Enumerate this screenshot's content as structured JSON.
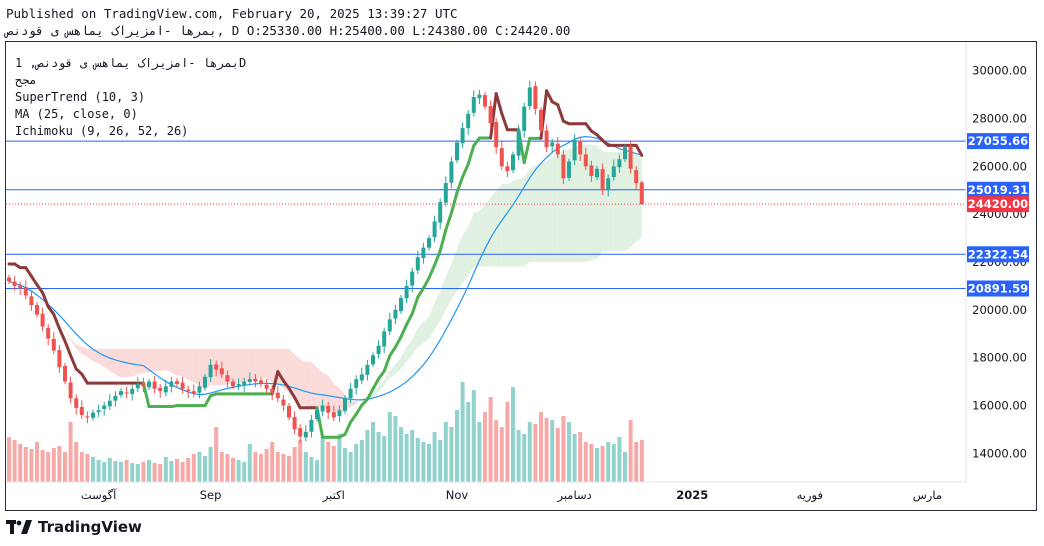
{
  "header": {
    "line1": "Published on TradingView.com, February 20, 2025 13:39:27 UTC",
    "line2": "بمرها -امزیراک یماهس ی قودنص, D O:25330.00 H:25400.00 L:24380.00 C:24420.00"
  },
  "legend": {
    "symbol": "بمرها -امزیراک یماهس ی قودنص, 1D",
    "line2": "مجح",
    "supertrend": "SuperTrend (10, 3)",
    "ma": "MA (25, close, 0)",
    "ichimoku": "Ichimoku (9, 26, 52, 26)"
  },
  "brand": {
    "name": "TradingView",
    "logo_icon": "tradingview-logo-icon"
  },
  "colors": {
    "up": "#26a69a",
    "down": "#ef5350",
    "supertrend_up": "#4caf50",
    "supertrend_down": "#8d3a3a",
    "ma": "#2196f3",
    "level": "#2962ff",
    "cloud_bull": "#c8e6c9",
    "cloud_bear": "#f8bbbb",
    "current_price": "#f23645"
  },
  "chart_data": {
    "type": "candlestick",
    "yticks": [
      14000,
      16000,
      18000,
      20000,
      22000,
      24000,
      26000,
      28000,
      30000
    ],
    "ylim": [
      12800,
      31200
    ],
    "xtick_labels": [
      "آگوست",
      "Sep",
      "اکتبر",
      "Nov",
      "دسامبر",
      "2025",
      "فوریه",
      "مارس"
    ],
    "levels": [
      27055.66,
      25019.31,
      22322.54,
      20891.59
    ],
    "level_labels": [
      "27055.66",
      "25019.31",
      "22322.54",
      "20891.59"
    ],
    "current_price": 24420.0,
    "current_price_label": "24420.00",
    "ohlc": {
      "open": 25330.0,
      "high": 25400.0,
      "low": 24380.0,
      "close": 24420.0
    },
    "closes": [
      21200,
      21000,
      20900,
      20600,
      20200,
      19800,
      19300,
      18800,
      18300,
      17600,
      17000,
      16300,
      15900,
      15600,
      15500,
      15700,
      15800,
      16000,
      16200,
      16400,
      16600,
      16500,
      16700,
      16900,
      16800,
      17000,
      16700,
      16600,
      16800,
      17000,
      16900,
      16700,
      16600,
      16500,
      16800,
      17200,
      17700,
      17500,
      17300,
      17000,
      16800,
      16900,
      17000,
      17100,
      17000,
      16900,
      16700,
      16500,
      16300,
      16000,
      15500,
      15000,
      14700,
      14900,
      15400,
      15800,
      16000,
      15700,
      15500,
      15800,
      16300,
      16700,
      17100,
      17300,
      17700,
      18100,
      18500,
      19100,
      19600,
      20000,
      20500,
      21000,
      21600,
      22200,
      22600,
      23000,
      23700,
      24500,
      25300,
      26200,
      27000,
      27600,
      28200,
      28900,
      29000,
      28500,
      27800,
      26800,
      26000,
      25800,
      26500,
      27500,
      28500,
      29300,
      28400,
      27500,
      26800,
      27000,
      26500,
      25500,
      26200,
      27100,
      26500,
      26000,
      25600,
      25900,
      25000,
      25500,
      26000,
      26300,
      26800,
      25900,
      25300,
      24420
    ],
    "volume": [
      0.45,
      0.42,
      0.38,
      0.35,
      0.33,
      0.4,
      0.32,
      0.3,
      0.34,
      0.36,
      0.3,
      0.6,
      0.4,
      0.3,
      0.28,
      0.25,
      0.22,
      0.2,
      0.24,
      0.21,
      0.2,
      0.22,
      0.19,
      0.18,
      0.2,
      0.22,
      0.19,
      0.18,
      0.25,
      0.21,
      0.23,
      0.2,
      0.24,
      0.28,
      0.3,
      0.26,
      0.35,
      0.55,
      0.3,
      0.28,
      0.24,
      0.22,
      0.2,
      0.38,
      0.3,
      0.28,
      0.33,
      0.4,
      0.3,
      0.28,
      0.26,
      0.35,
      0.42,
      0.3,
      0.25,
      0.22,
      0.45,
      0.4,
      0.36,
      0.48,
      0.34,
      0.3,
      0.38,
      0.42,
      0.52,
      0.6,
      0.5,
      0.46,
      0.7,
      0.66,
      0.55,
      0.48,
      0.52,
      0.44,
      0.4,
      0.38,
      0.5,
      0.42,
      0.6,
      0.55,
      0.72,
      1.0,
      0.8,
      0.92,
      0.6,
      0.7,
      0.85,
      0.62,
      0.55,
      0.8,
      0.95,
      0.52,
      0.48,
      0.6,
      0.58,
      0.7,
      0.64,
      0.62,
      0.54,
      0.66,
      0.6,
      0.48,
      0.5,
      0.4,
      0.38,
      0.34,
      0.36,
      0.4,
      0.38,
      0.45,
      0.3,
      0.62,
      0.4,
      0.42
    ]
  }
}
